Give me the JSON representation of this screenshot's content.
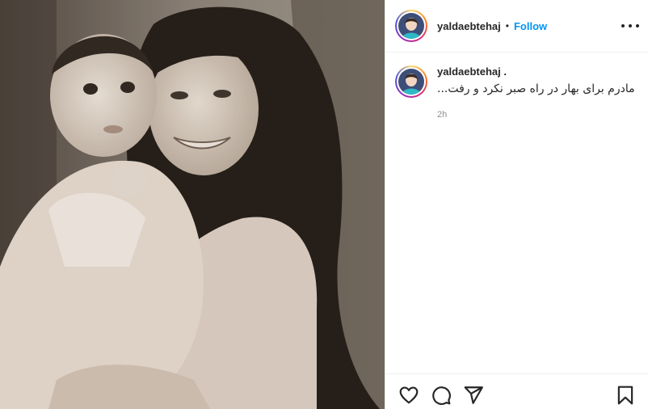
{
  "post": {
    "author": {
      "username": "yaldaebtehaj",
      "follow_label": "Follow",
      "separator": "•",
      "avatar_icon": "profile-avatar"
    },
    "caption": {
      "username": "yaldaebtehaj .",
      "text": "...مادرم برای بهار در راه صبر نکرد و رفت",
      "time": "2h"
    },
    "actions": {
      "like_icon": "heart-icon",
      "comment_icon": "comment-icon",
      "share_icon": "send-icon",
      "save_icon": "bookmark-icon",
      "more_icon": "more-options-icon"
    },
    "colors": {
      "follow": "#0095f6",
      "text": "#262626",
      "muted": "#8e8e8e",
      "border": "#efefef"
    }
  }
}
